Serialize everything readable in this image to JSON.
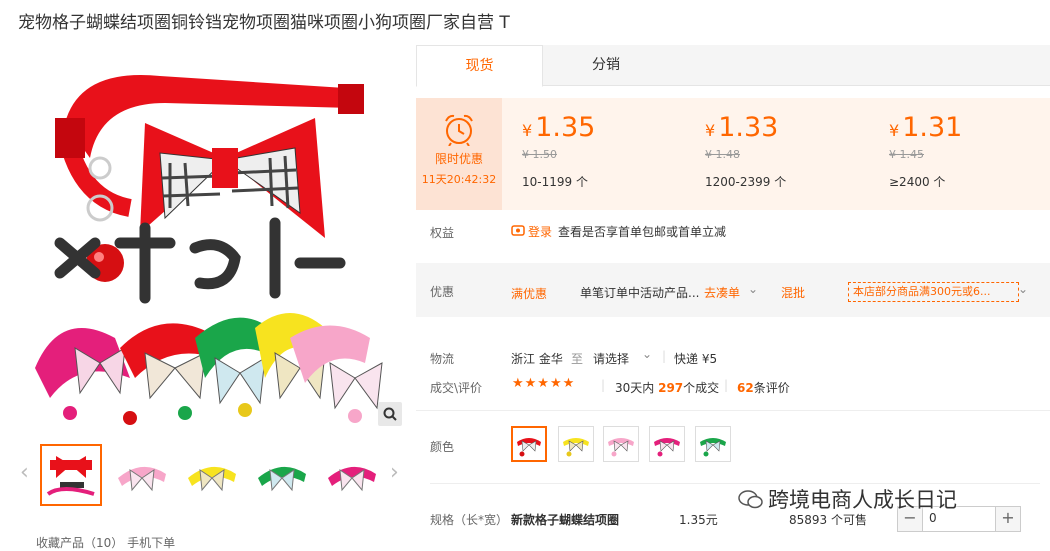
{
  "title": "宠物格子蝴蝶结项圈铜铃铛宠物项圈猫咪项圈小狗项圈厂家自营 T",
  "tabs": {
    "spot": "现货",
    "distribution": "分销"
  },
  "promo": {
    "label": "限时优惠",
    "countdown": "11天20:42:32"
  },
  "currency": "¥",
  "tiers": [
    {
      "price": "1.35",
      "original": "¥ 1.50",
      "range": "10-1199 个"
    },
    {
      "price": "1.33",
      "original": "¥ 1.48",
      "range": "1200-2399 个"
    },
    {
      "price": "1.31",
      "original": "¥ 1.45",
      "range": "≥2400 个"
    }
  ],
  "rights": {
    "label": "权益",
    "login": "登录",
    "text": "查看是否享首单包邮或首单立减"
  },
  "discount": {
    "label": "优惠",
    "full": "满优惠",
    "desc": "单笔订单中活动产品...",
    "gather": "去凑单",
    "mixed": "混批",
    "store": "本店部分商品满300元或6..."
  },
  "logistics": {
    "label": "物流",
    "from": "浙江 金华",
    "to_word": "至",
    "select": "请选择",
    "express": "快递 ¥5"
  },
  "deals": {
    "label": "成交\\评价",
    "stars": "★★★★★",
    "period": "30天内",
    "count": "297",
    "count_suffix": "个成交",
    "reviews": "62",
    "reviews_suffix": "条评价"
  },
  "color": {
    "label": "颜色"
  },
  "spec": {
    "label": "规格（长*宽）",
    "name": "新款格子蝴蝶结项圈",
    "price": "1.35元",
    "stock": "85893 个可售",
    "qty": "0",
    "minus": "−",
    "plus": "+"
  },
  "watermark": "跨境电商人成长日记",
  "fav": "收藏产品（10）    手机下单",
  "brand_colors": {
    "accent": "#ff6600",
    "red": "#e8111a"
  },
  "collar_colors": [
    "#e8111a",
    "#f7e31f",
    "#f7a6c9",
    "#e41f7b",
    "#1aa64a"
  ]
}
